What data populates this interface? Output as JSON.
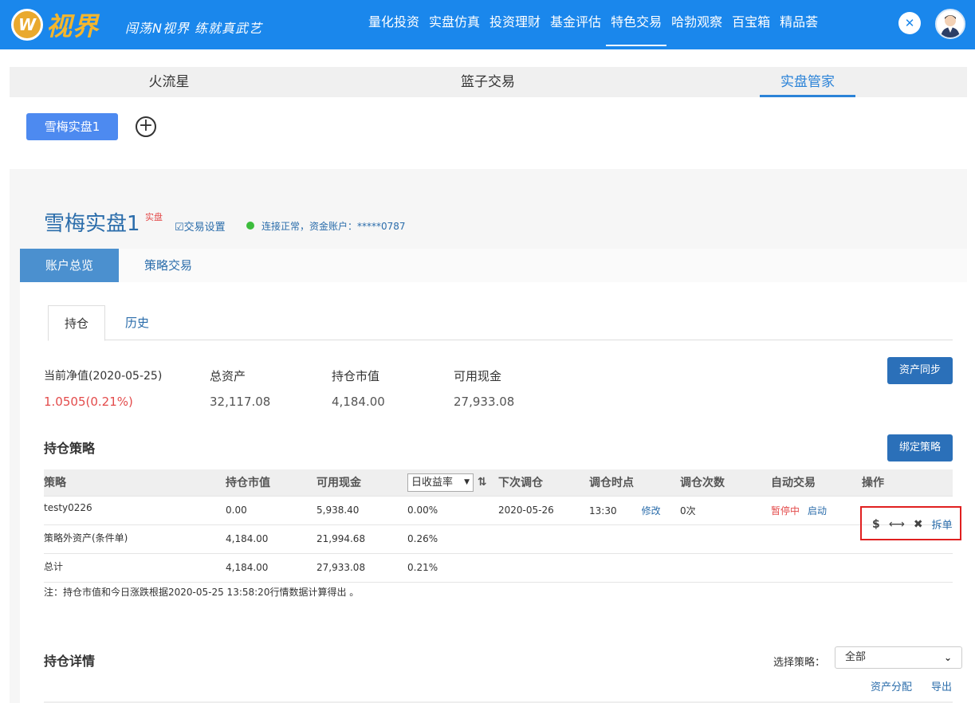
{
  "header": {
    "logo_mark": "W",
    "logo_text": "视界",
    "slogan": "闯荡N视界 练就真武艺",
    "nav": [
      "量化投资",
      "实盘仿真",
      "投资理财",
      "基金评估",
      "特色交易",
      "哈勃观察",
      "百宝箱",
      "精品荟"
    ],
    "active_nav": "特色交易",
    "tool_icon": "tools-icon",
    "avatar_icon": "user-avatar-icon"
  },
  "subtabs": [
    "火流星",
    "篮子交易",
    "实盘管家"
  ],
  "account": {
    "button_label": "雪梅实盘1",
    "add_icon": "plus-circle-icon",
    "title": "雪梅实盘1",
    "sup_label": "实盘",
    "trade_settings": "交易设置",
    "status": "连接正常，资金账户：*****0787",
    "status_color": "#3dbd3d"
  },
  "main_tabs": [
    "账户总览",
    "策略交易"
  ],
  "position_tabs": [
    "持仓",
    "历史"
  ],
  "stats": [
    {
      "label": "当前净值(2020-05-25)",
      "value": "1.0505(0.21%)"
    },
    {
      "label": "总资产",
      "value": "32,117.08"
    },
    {
      "label": "持仓市值",
      "value": "4,184.00"
    },
    {
      "label": "可用现金",
      "value": "27,933.08"
    }
  ],
  "sync_button": "资产同步",
  "bind_button": "绑定策略",
  "holding_title": "持仓策略",
  "table": {
    "headers": [
      "策略",
      "持仓市值",
      "可用现金",
      "日收益率",
      "下次调仓",
      "调仓时点",
      "调仓次数",
      "自动交易",
      "操作"
    ],
    "rows": [
      {
        "name": "testy0226",
        "mv": "0.00",
        "cash": "5,938.40",
        "ret": "0.00%",
        "next": "2020-05-26",
        "time": "13:30",
        "edit": "修改",
        "count": "0次",
        "auto_status": "暂停中",
        "auto_action": "启动"
      },
      {
        "name": "策略外资产(条件单)",
        "mv": "4,184.00",
        "cash": "21,994.68",
        "ret": "0.26%"
      },
      {
        "name": "总计",
        "mv": "4,184.00",
        "cash": "27,933.08",
        "ret": "0.21%"
      }
    ],
    "ops": {
      "dollar": "$",
      "transfer": "⟷",
      "close": "✖",
      "split": "拆单"
    }
  },
  "note": "注：持仓市值和今日涨跌根据2020-05-25 13:58:20行情数据计算得出 。",
  "detail": {
    "title": "持仓详情",
    "select_label": "选择策略：",
    "select_value": "全部",
    "asset_link": "资产分配",
    "export_link": "导出"
  }
}
